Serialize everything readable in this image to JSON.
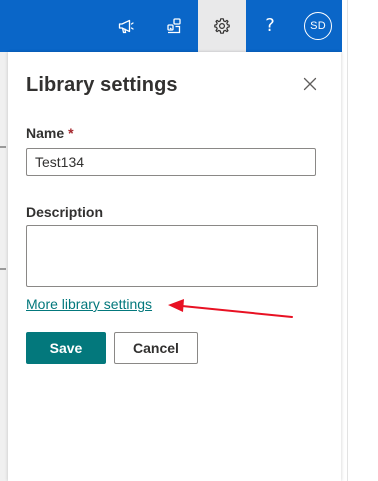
{
  "suite_bar": {
    "buttons": [
      {
        "icon": "megaphone-icon"
      },
      {
        "icon": "apps-switch-icon"
      },
      {
        "icon": "gear-icon",
        "active": true
      },
      {
        "icon": "help-icon",
        "label": "?"
      },
      {
        "icon": "avatar",
        "label": "SD"
      }
    ],
    "colors": {
      "bar": "#0a66c8",
      "active": "#e9e9ea"
    }
  },
  "panel": {
    "title": "Library settings",
    "name_field": {
      "label": "Name",
      "required_marker": "*",
      "value": "Test134"
    },
    "description_field": {
      "label": "Description",
      "value": ""
    },
    "more_link": "More library settings",
    "save_label": "Save",
    "cancel_label": "Cancel"
  },
  "colors": {
    "accent": "#03787c",
    "required": "#a4262c",
    "annotation_arrow": "#e81123"
  }
}
